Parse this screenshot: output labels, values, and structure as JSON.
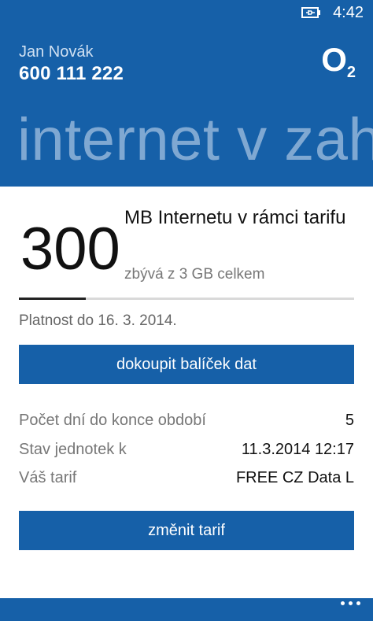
{
  "status_bar": {
    "time": "4:42",
    "battery_icon": "battery-charging-icon"
  },
  "header": {
    "user_name": "Jan Novák",
    "phone_number": "600 111 222",
    "logo": {
      "text": "O",
      "sub": "2"
    },
    "panorama_title": "internet v zah"
  },
  "data_usage": {
    "remaining": "300",
    "title": "MB Internetu v rámci tarifu",
    "subtitle": "zbývá z 3 GB celkem",
    "used_fraction": 0.2
  },
  "validity": "Platnost do 16. 3. 2014.",
  "buy_button": "dokoupit balíček dat",
  "info": [
    {
      "label": "Počet dní do konce období",
      "value": "5"
    },
    {
      "label": "Stav jednotek k",
      "value": "11.3.2014 12:17"
    },
    {
      "label": "Váš tarif",
      "value": "FREE CZ Data L"
    }
  ],
  "change_button": "změnit tarif",
  "app_bar": {
    "more_icon": "ellipsis-icon"
  },
  "colors": {
    "accent": "#1660a8",
    "panorama_text": "#7fa8d2"
  }
}
